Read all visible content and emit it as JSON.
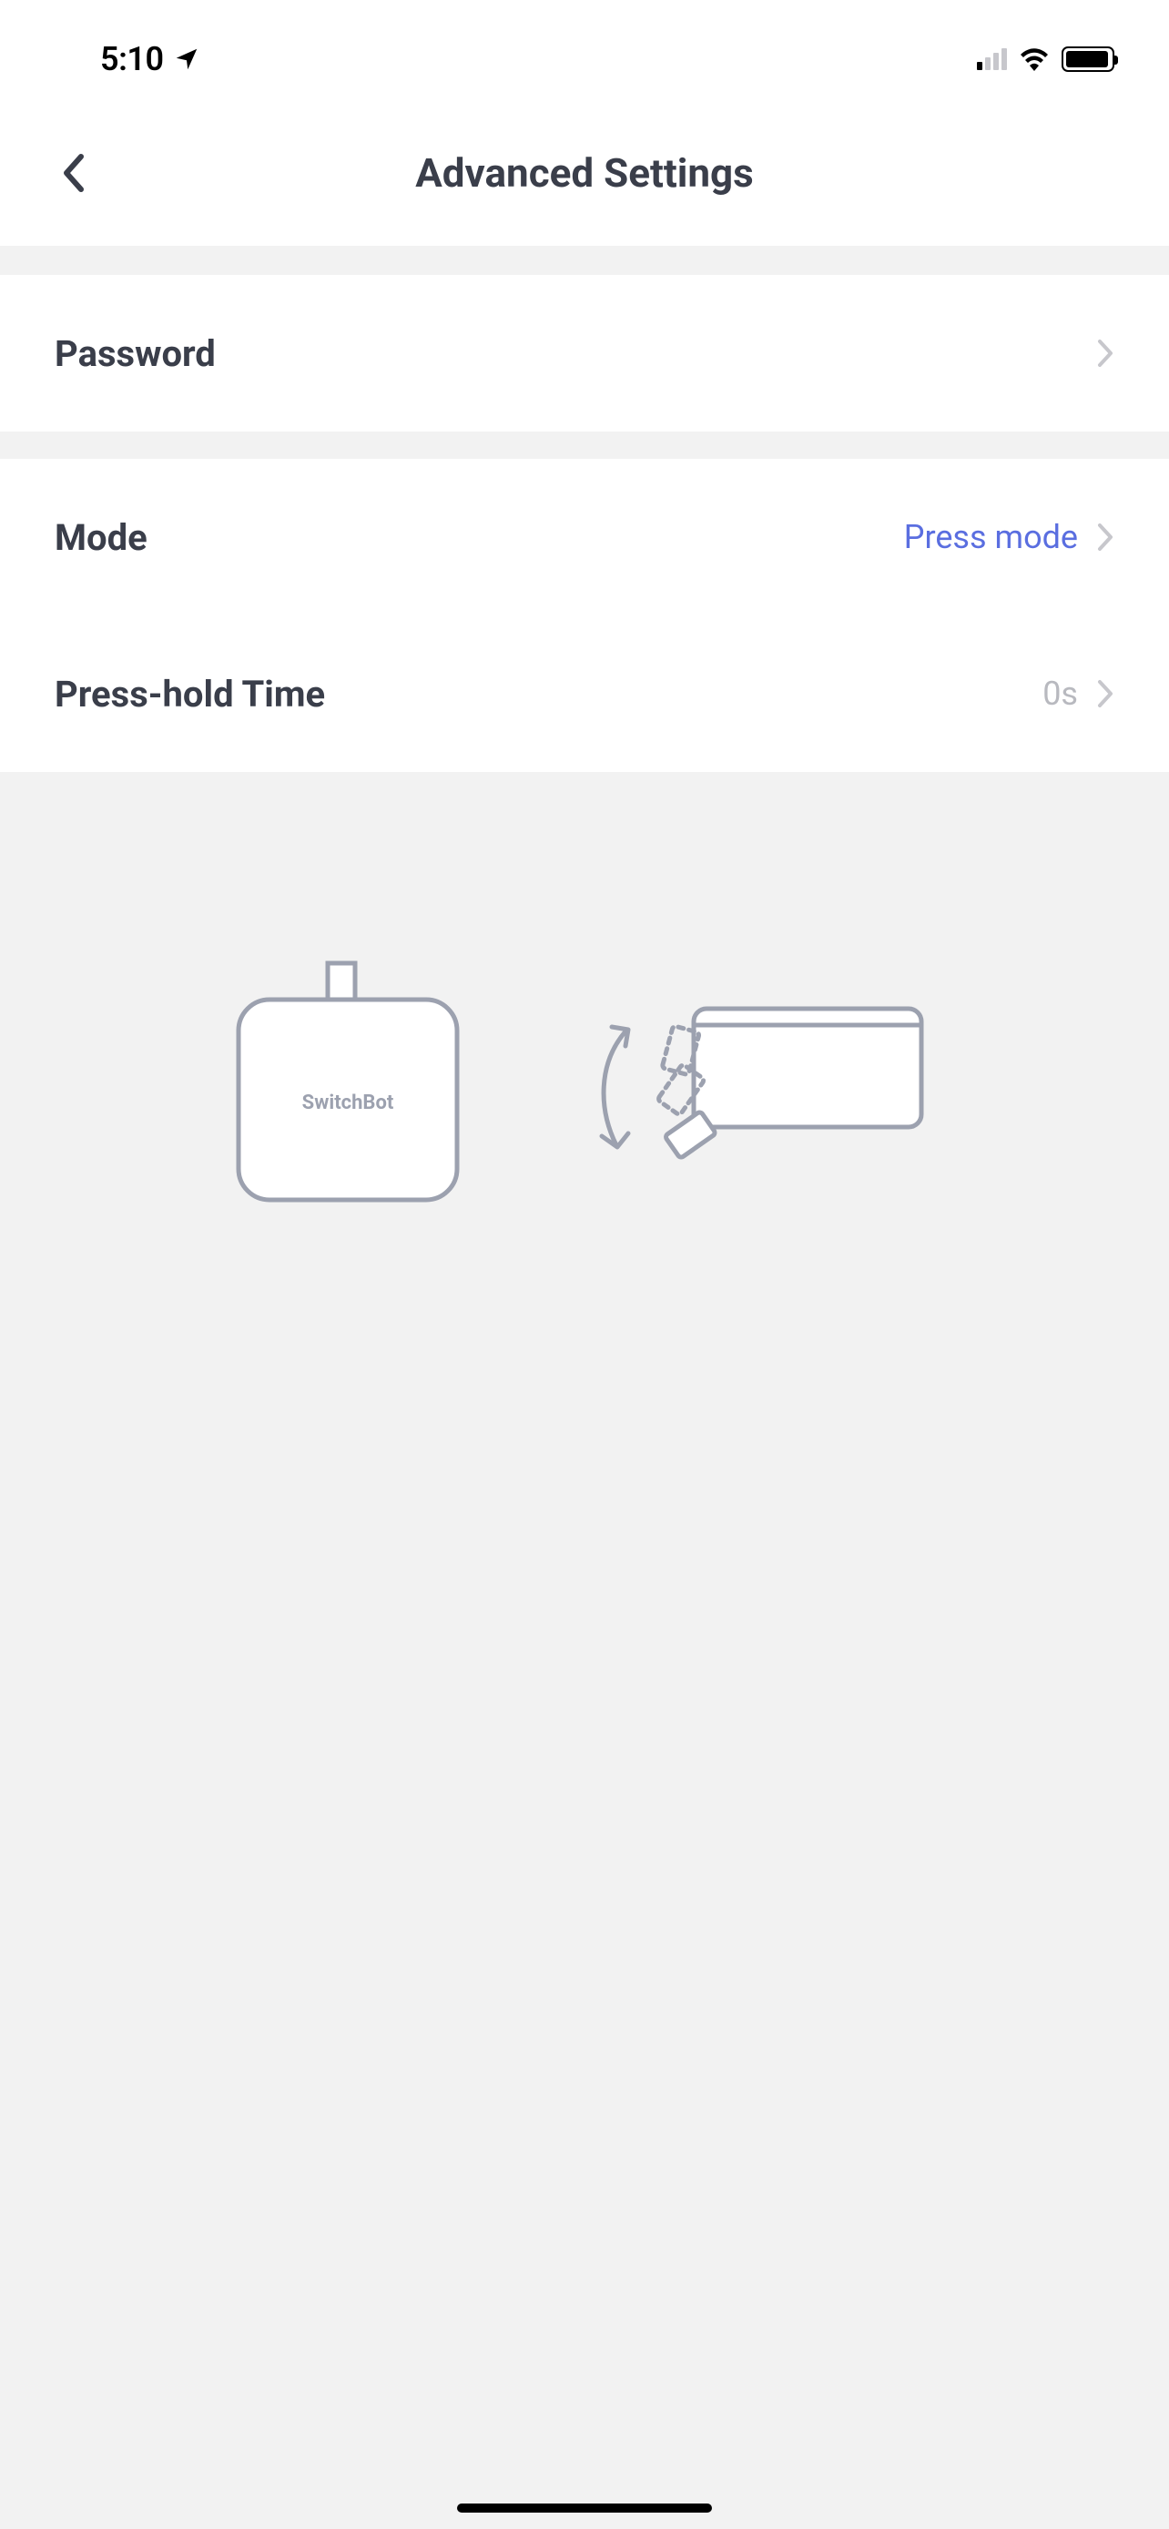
{
  "status_bar": {
    "time": "5:10"
  },
  "header": {
    "title": "Advanced Settings"
  },
  "rows": {
    "password": {
      "label": "Password"
    },
    "mode": {
      "label": "Mode",
      "value": "Press mode"
    },
    "press_hold": {
      "label": "Press-hold Time",
      "value": "0s"
    }
  },
  "illustration": {
    "device_label": "SwitchBot"
  }
}
